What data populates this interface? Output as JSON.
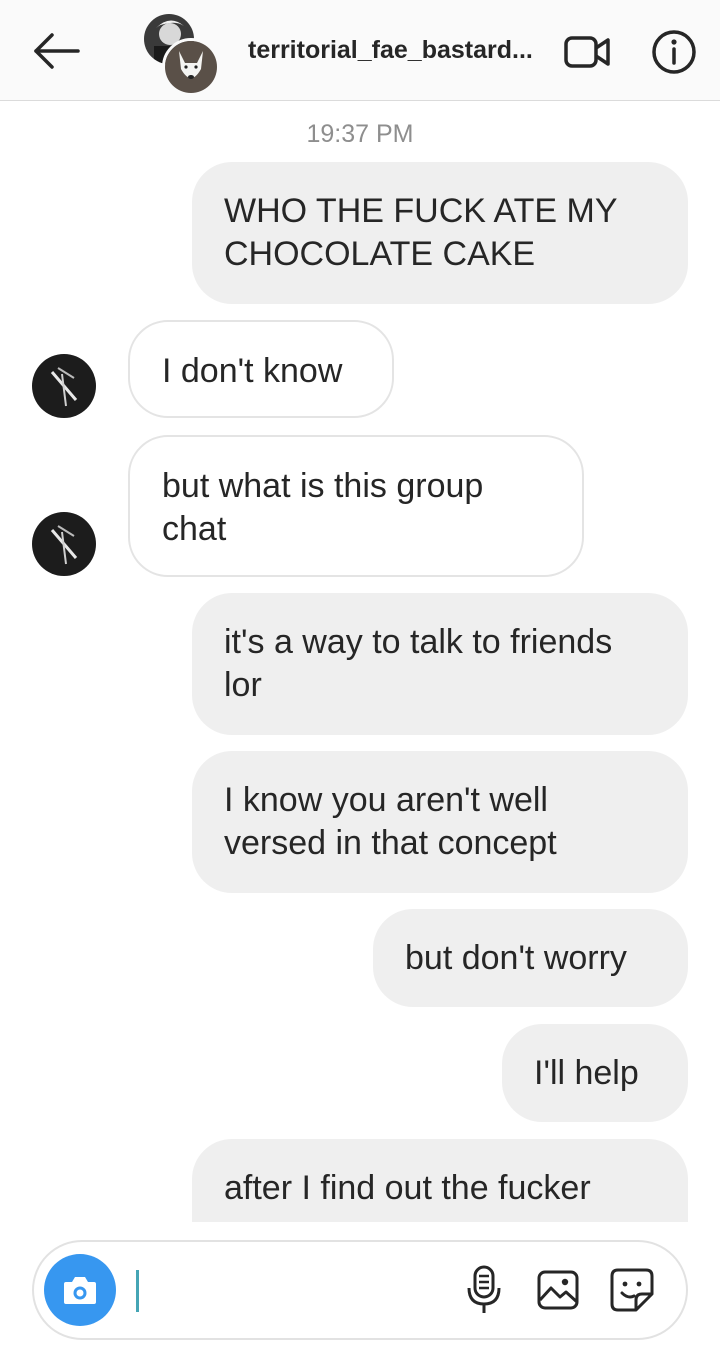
{
  "header": {
    "title": "territorial_fae_bastard...",
    "back_icon": "arrow-left-icon",
    "video_icon": "video-call-icon",
    "info_icon": "info-icon"
  },
  "thread": {
    "timestamp": "19:37 PM",
    "messages": [
      {
        "direction": "outgoing",
        "text": "WHO THE FUCK ATE MY\nCHOCOLATE CAKE"
      },
      {
        "direction": "incoming",
        "text": "I don't know"
      },
      {
        "direction": "incoming",
        "text": "but what is this group\nchat"
      },
      {
        "direction": "outgoing",
        "text": "it's a way to talk to friends\nlor"
      },
      {
        "direction": "outgoing",
        "text": "I know you aren't well\nversed in that concept"
      },
      {
        "direction": "outgoing",
        "text": "but don't worry"
      },
      {
        "direction": "outgoing",
        "text": "I'll help"
      },
      {
        "direction": "outgoing",
        "text": "after I find out the fucker"
      }
    ]
  },
  "composer": {
    "camera_icon": "camera-icon",
    "mic_icon": "microphone-icon",
    "gallery_icon": "gallery-icon",
    "sticker_icon": "sticker-icon"
  },
  "colors": {
    "accent": "#3797f0",
    "outgoing_bubble": "#efefef",
    "incoming_border": "#e4e4e4",
    "timestamp": "#8e8e8e"
  }
}
